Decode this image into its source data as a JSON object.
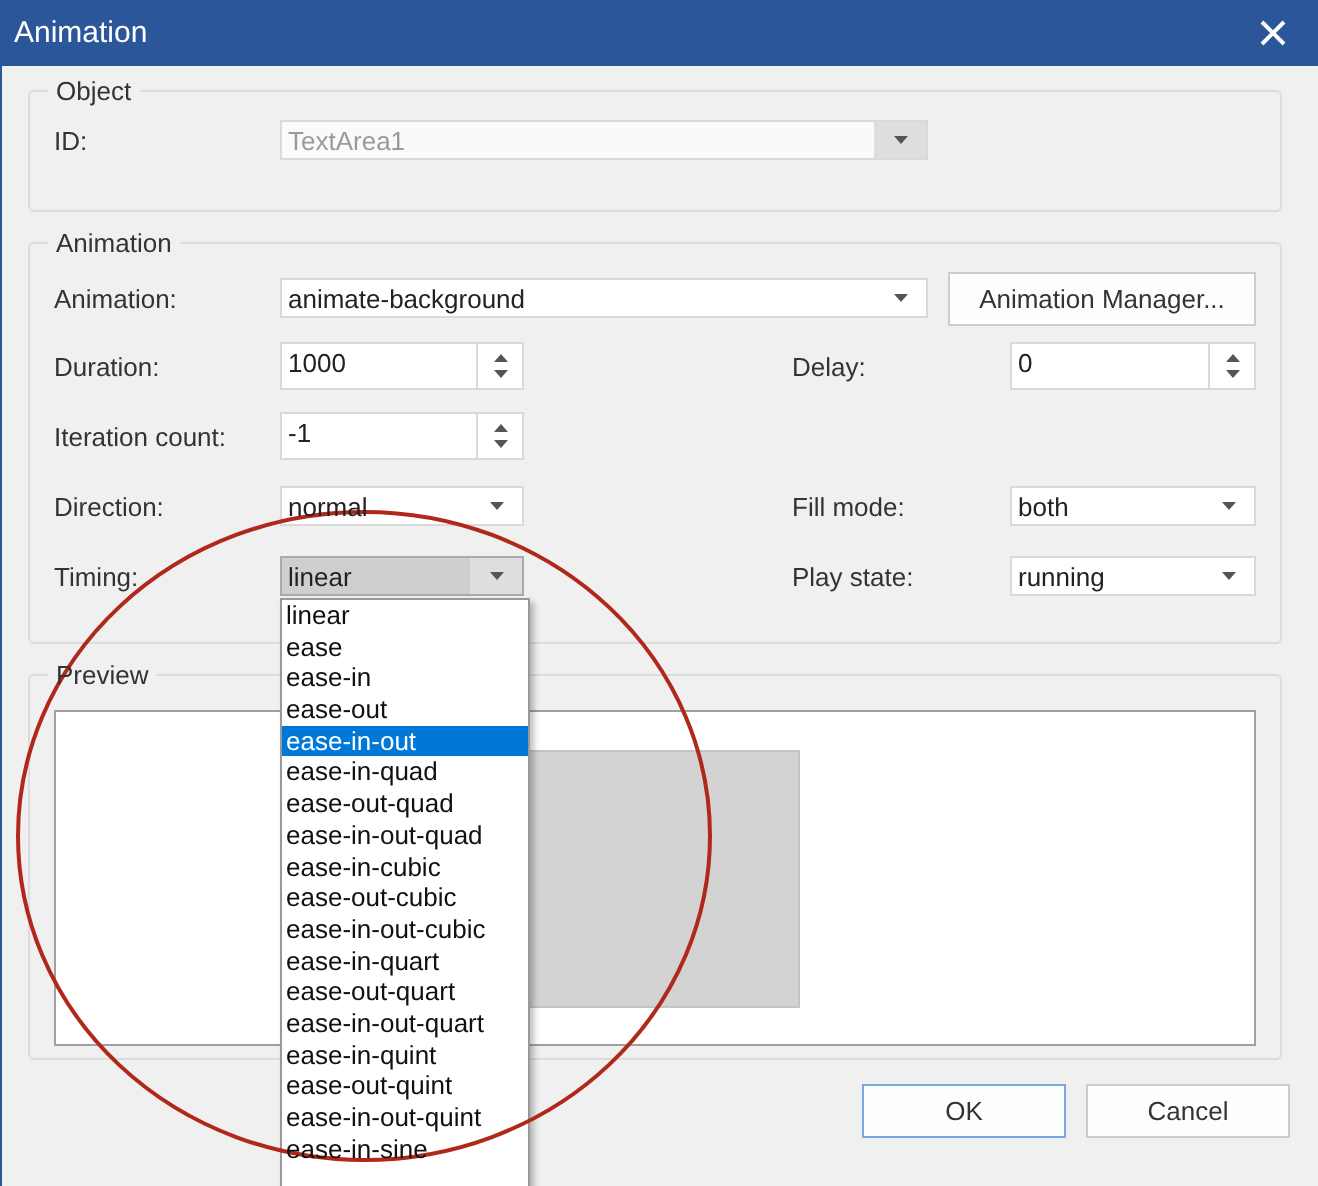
{
  "window": {
    "title": "Animation"
  },
  "object_group": {
    "title": "Object",
    "id_label": "ID:",
    "id_value": "TextArea1",
    "disabled": true
  },
  "animation_group": {
    "title": "Animation",
    "animation": {
      "label": "Animation:",
      "value": "animate-background",
      "button": "Animation Manager..."
    },
    "rows": [
      {
        "left": {
          "kind": "spin",
          "label": "Duration:",
          "value": "1000"
        },
        "right": {
          "kind": "spin",
          "label": "Delay:",
          "value": "0"
        }
      },
      {
        "left": {
          "kind": "spin",
          "label": "Iteration count:",
          "value": "-1"
        }
      },
      {
        "left": {
          "kind": "combo",
          "label": "Direction:",
          "value": "normal"
        },
        "right": {
          "kind": "combo",
          "label": "Fill mode:",
          "value": "both"
        }
      },
      {
        "left": {
          "kind": "combo",
          "label": "Timing:",
          "value": "linear",
          "open": true
        },
        "right": {
          "kind": "combo",
          "label": "Play state:",
          "value": "running"
        }
      }
    ]
  },
  "timing_options": [
    {
      "label": "linear",
      "selected": false
    },
    {
      "label": "ease",
      "selected": false
    },
    {
      "label": "ease-in",
      "selected": false
    },
    {
      "label": "ease-out",
      "selected": false
    },
    {
      "label": "ease-in-out",
      "selected": true
    },
    {
      "label": "ease-in-quad",
      "selected": false
    },
    {
      "label": "ease-out-quad",
      "selected": false
    },
    {
      "label": "ease-in-out-quad",
      "selected": false
    },
    {
      "label": "ease-in-cubic",
      "selected": false
    },
    {
      "label": "ease-out-cubic",
      "selected": false
    },
    {
      "label": "ease-in-out-cubic",
      "selected": false
    },
    {
      "label": "ease-in-quart",
      "selected": false
    },
    {
      "label": "ease-out-quart",
      "selected": false
    },
    {
      "label": "ease-in-out-quart",
      "selected": false
    },
    {
      "label": "ease-in-quint",
      "selected": false
    },
    {
      "label": "ease-out-quint",
      "selected": false
    },
    {
      "label": "ease-in-out-quint",
      "selected": false
    },
    {
      "label": "ease-in-sine",
      "selected": false
    }
  ],
  "preview": {
    "title": "Preview"
  },
  "buttons": [
    {
      "label": "OK",
      "default": true
    },
    {
      "label": "Cancel",
      "default": false
    }
  ]
}
